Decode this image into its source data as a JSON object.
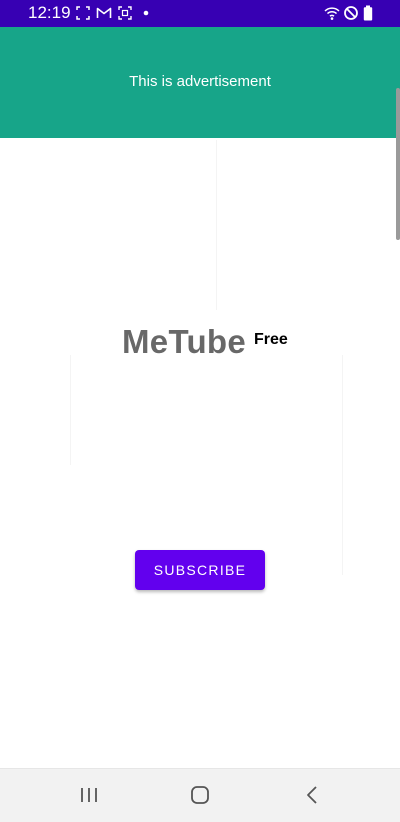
{
  "status_bar": {
    "time": "12:19",
    "background_color": "#3700b3",
    "left_icons": [
      "screenshot-frame-icon",
      "gmail-icon",
      "screen-record-icon",
      "notification-dot-icon"
    ],
    "right_icons": [
      "wifi-icon",
      "do-not-disturb-icon",
      "battery-icon"
    ]
  },
  "ad_banner": {
    "text": "This is advertisement",
    "background_color": "#17a589"
  },
  "main": {
    "title": "MeTube",
    "badge": "Free",
    "subscribe_label": "SUBSCRIBE",
    "accent_color": "#6200ee"
  },
  "nav_bar": {
    "buttons": [
      "recent-apps-icon",
      "home-icon",
      "back-icon"
    ]
  }
}
